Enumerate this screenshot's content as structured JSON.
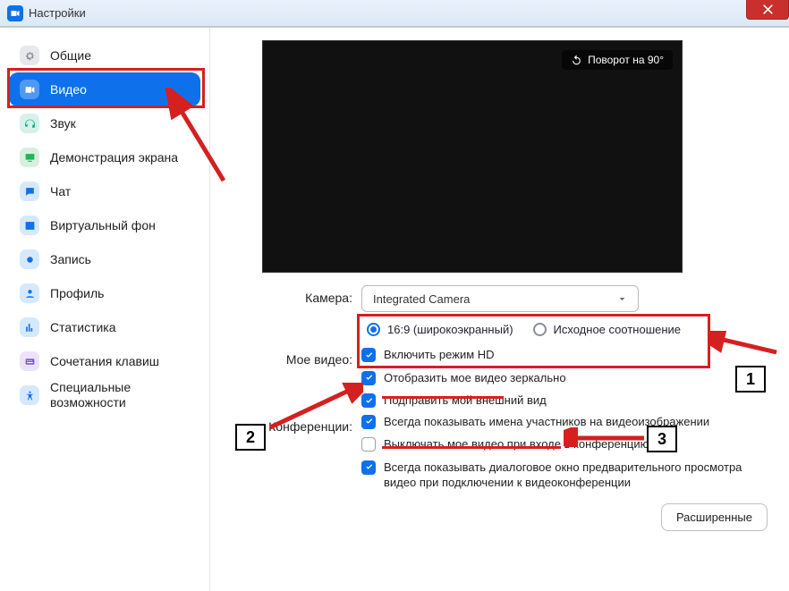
{
  "titlebar": {
    "title": "Настройки"
  },
  "sidebar": {
    "items": [
      {
        "label": "Общие",
        "icon": "gear"
      },
      {
        "label": "Видео",
        "icon": "video"
      },
      {
        "label": "Звук",
        "icon": "headphones"
      },
      {
        "label": "Демонстрация экрана",
        "icon": "share-screen"
      },
      {
        "label": "Чат",
        "icon": "chat"
      },
      {
        "label": "Виртуальный фон",
        "icon": "background"
      },
      {
        "label": "Запись",
        "icon": "record"
      },
      {
        "label": "Профиль",
        "icon": "profile"
      },
      {
        "label": "Статистика",
        "icon": "stats"
      },
      {
        "label": "Сочетания клавиш",
        "icon": "keyboard"
      },
      {
        "label": "Специальные возможности",
        "icon": "accessibility"
      }
    ]
  },
  "preview": {
    "rotate_label": "Поворот на 90°"
  },
  "camera": {
    "section_label": "Камера:",
    "selected": "Integrated Camera",
    "ratio_wide": "16:9 (широкоэкранный)",
    "ratio_orig": "Исходное соотношение"
  },
  "myvideo": {
    "section_label": "Мое видео:",
    "hd": "Включить режим HD",
    "mirror": "Отобразить мое видео зеркально",
    "touchup": "Подправить мой внешний вид"
  },
  "meetings": {
    "section_label": "Конференции:",
    "show_names": "Всегда показывать имена участников на видеоизображении",
    "mute_video": "Выключать мое видео при входе в конференцию",
    "preview_dialog": "Всегда показывать диалоговое окно предварительного просмотра видео при подключении к видеоконференции"
  },
  "advanced_label": "Расширенные",
  "annotations": {
    "n1": "1",
    "n2": "2",
    "n3": "3"
  }
}
